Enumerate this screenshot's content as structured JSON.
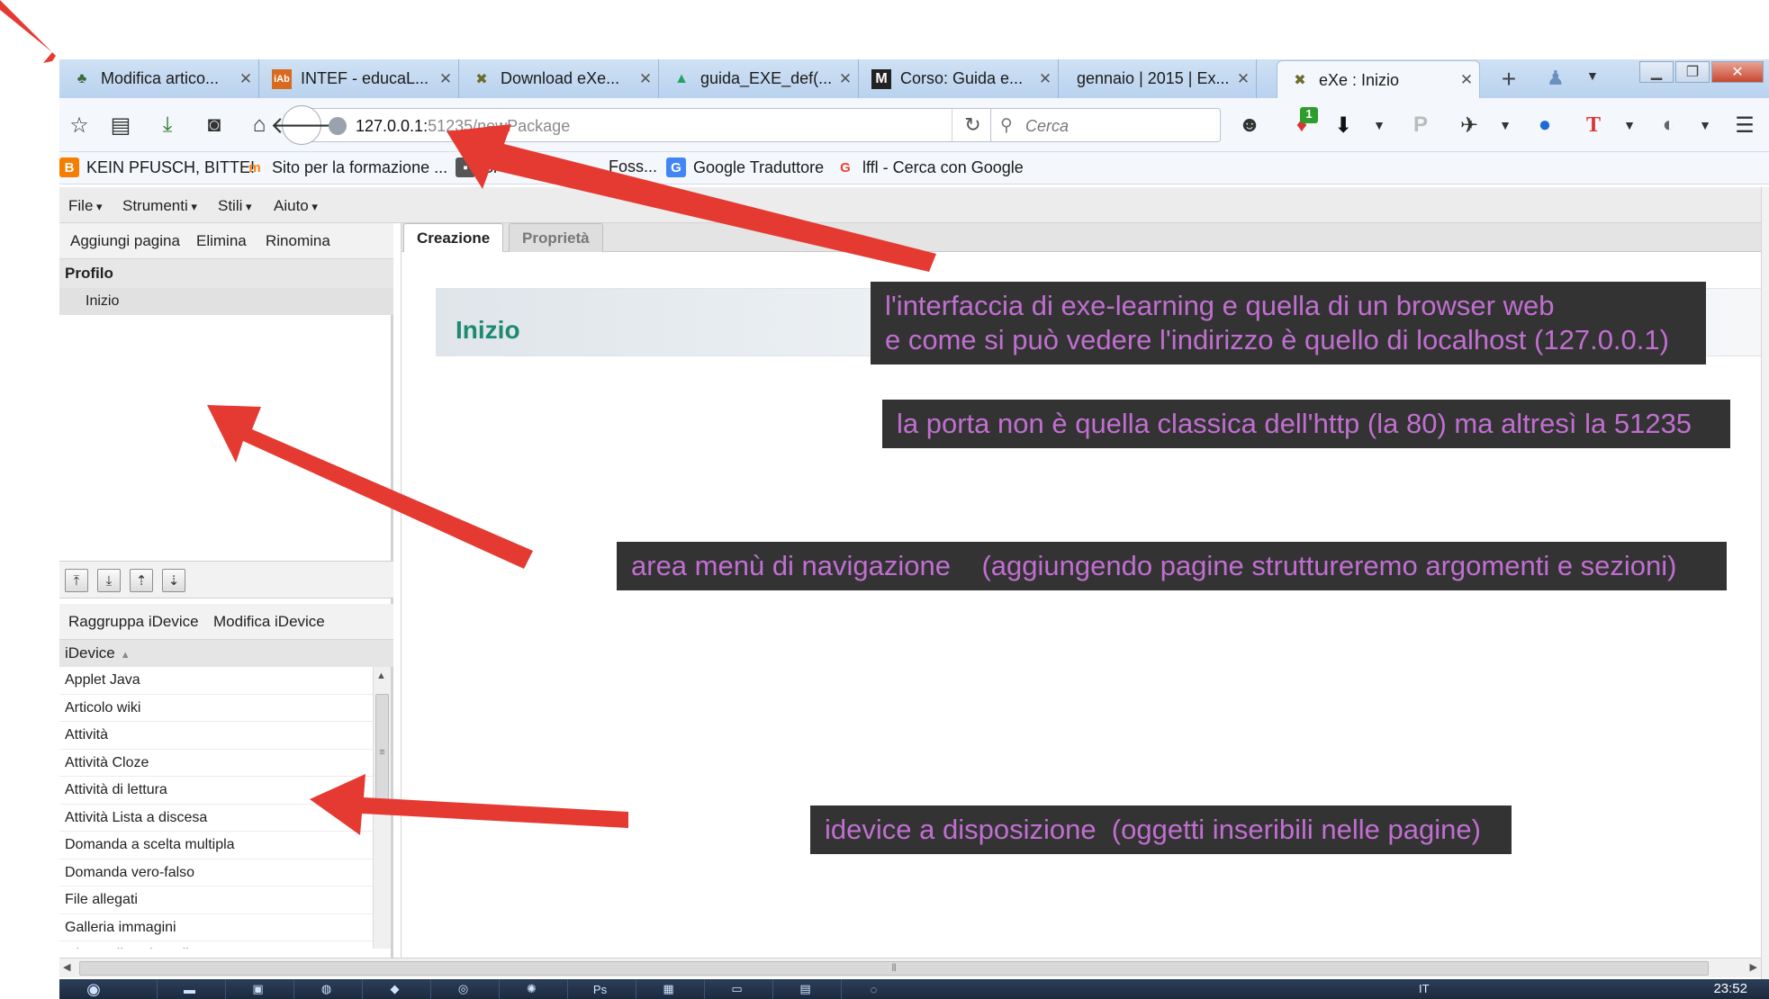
{
  "browser": {
    "tabs": [
      {
        "label": "Modifica artico...",
        "icon": "tree-icon",
        "color": "#3a6a3a"
      },
      {
        "label": "INTEF - educaL...",
        "icon": "intef-icon",
        "color": "#d86a1e"
      },
      {
        "label": "Download eXe...",
        "icon": "exe-icon",
        "color": "#6b6b2a"
      },
      {
        "label": "guida_EXE_def(...",
        "icon": "google-drive-icon",
        "color": "#1fa463"
      },
      {
        "label": "Corso: Guida e...",
        "icon": "moodle-icon",
        "color": "#222222"
      },
      {
        "label": "gennaio | 2015 | Ex...",
        "icon": "",
        "color": "#000000"
      },
      {
        "label": "eXe : Inizio",
        "icon": "exe-icon",
        "color": "#6b6b2a"
      }
    ],
    "new_tab": "+",
    "url_host": "127.0.0.1:",
    "url_rest": "51235/newPackage",
    "search_placeholder": "Cerca",
    "addon_badge": "1",
    "bookmarks": [
      {
        "label": "KEIN PFUSCH, BITTE!",
        "icon": "blogger-icon",
        "color": "#f57d00"
      },
      {
        "label": "Sito per la formazione ...",
        "icon": "moodle-icon",
        "color": "#f98012"
      },
      {
        "label": "Si",
        "icon": "page-icon",
        "color": "#555555"
      },
      {
        "label": "Foss...",
        "icon": "page-icon",
        "color": "#555555"
      },
      {
        "label": "Google Traduttore",
        "icon": "translate-icon",
        "color": "#4285f4"
      },
      {
        "label": "lffl - Cerca con Google",
        "icon": "google-icon",
        "color": "#ea4335"
      }
    ]
  },
  "app": {
    "menus": [
      "File",
      "Strumenti",
      "Stili",
      "Aiuto"
    ],
    "outline_actions": [
      "Aggiungi pagina",
      "Elimina",
      "Rinomina"
    ],
    "outline_root": "Profilo",
    "outline_page": "Inizio",
    "idevice_actions": [
      "Raggruppa iDevice",
      "Modifica iDevice"
    ],
    "idevice_header": "iDevice",
    "idevices": [
      "Applet Java",
      "Articolo wiki",
      "Attività",
      "Attività Cloze",
      "Attività di lettura",
      "Attività Lista a discesa",
      "Domanda a scelta multipla",
      "Domanda vero-falso",
      "File allegati",
      "Galleria immagini",
      "Gioco Clicca in ordine"
    ],
    "tabs": [
      "Creazione",
      "Proprietà"
    ],
    "page_title": "Inizio"
  },
  "annotations": {
    "browser_note_line1": "l'interfaccia di exe-learning e quella di un browser web",
    "browser_note_line2": "e come si può vedere l'indirizzo è quello di localhost (127.0.0.1)",
    "port_note": "la porta non è quella classica dell'http (la 80) ma altresì la 51235",
    "nav_note": "area menù di navigazione    (aggiungendo pagine struttureremo argomenti e sezioni)",
    "idevice_note": "idevice a disposizione  (oggetti inseribili nelle pagine)",
    "arrow_color": "#e53a32",
    "note_text_color": "#c06fd0"
  },
  "taskbar": {
    "clock": "23:52",
    "lang": "IT"
  }
}
